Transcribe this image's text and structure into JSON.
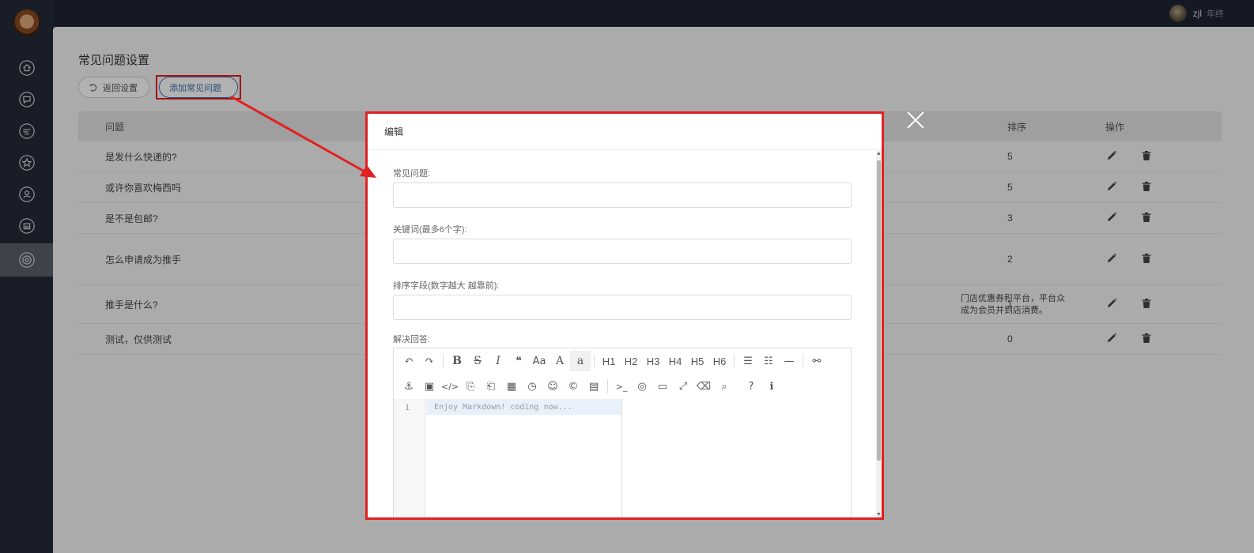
{
  "header": {
    "username": "zjl",
    "logout": "年终"
  },
  "sidebar": {
    "items": [
      {
        "icon": "home-icon"
      },
      {
        "icon": "chat-icon"
      },
      {
        "icon": "message-icon"
      },
      {
        "icon": "star-icon"
      },
      {
        "icon": "user-icon"
      },
      {
        "icon": "store-icon"
      },
      {
        "icon": "settings-icon",
        "active": true
      }
    ]
  },
  "page": {
    "title": "常见问题设置",
    "back_label": "返回设置",
    "add_label": "添加常见问题"
  },
  "table": {
    "headers": {
      "question": "问题",
      "sort": "排序",
      "actions": "操作"
    },
    "rows": [
      {
        "question": "是发什么快递的?",
        "sort": "5"
      },
      {
        "question": "或许你喜欢梅西吗",
        "sort": "5"
      },
      {
        "question": "是不是包邮?",
        "sort": "3"
      },
      {
        "question": "怎么申请成为推手",
        "sort": "2"
      },
      {
        "question": "推手是什么?",
        "sort": "1",
        "answer_line1": "门店优惠券积平台，平台众",
        "answer_line2": "成为会员并到店消费。"
      },
      {
        "question": "测试，仅供测试",
        "sort": "0"
      }
    ]
  },
  "modal": {
    "title": "编辑",
    "faq_label": "常见问题:",
    "faq_value": "",
    "keywords_label": "关键词(最多6个字):",
    "keywords_value": "",
    "sort_label": "排序字段(数字越大 越靠前):",
    "sort_value": "",
    "answer_label": "解决回答:",
    "editor": {
      "line_number": "1",
      "placeholder": "Enjoy Markdown! coding now...",
      "toolbar_row1": [
        "↶",
        "↷",
        "B",
        "S",
        "I",
        "❝",
        "Aa",
        "A",
        "a",
        "H1",
        "H2",
        "H3",
        "H4",
        "H5",
        "H6",
        "list-ul",
        "list-ol",
        "hr",
        "link"
      ],
      "toolbar_row2": [
        "anchor",
        "image",
        "code",
        "code-block",
        "preformatted",
        "table",
        "datetime",
        "emoji",
        "html-entities",
        "pagebreak",
        "terminal",
        "watch",
        "preview",
        "fullscreen",
        "clear",
        "search",
        "help",
        "info"
      ]
    }
  }
}
